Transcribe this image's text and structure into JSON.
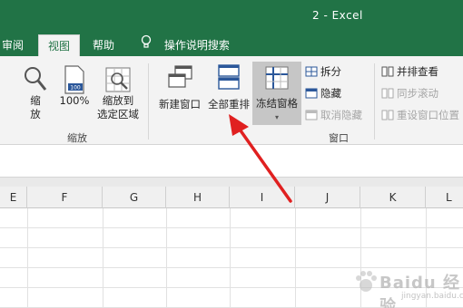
{
  "window": {
    "title": "2  -  Excel"
  },
  "tabs": [
    {
      "label": "审阅"
    },
    {
      "label": "视图"
    },
    {
      "label": "帮助"
    },
    {
      "label": "操作说明搜索"
    }
  ],
  "ribbon": {
    "zoom_group": {
      "zoom_label_1": "缩",
      "zoom_label_2": "放",
      "zoom100_label": "100%",
      "zoom_selection_1": "缩放到",
      "zoom_selection_2": "选定区域",
      "group_label": "缩放"
    },
    "window_group": {
      "new_window": "新建窗口",
      "arrange_all": "全部重排",
      "freeze_panes": "冻结窗格",
      "split": "拆分",
      "hide": "隐藏",
      "unhide": "取消隐藏",
      "view_side_by_side": "并排查看",
      "sync_scroll": "同步滚动",
      "reset_position": "重设窗口位置",
      "group_label": "窗口"
    }
  },
  "columns": [
    "E",
    "F",
    "G",
    "H",
    "I",
    "J",
    "K",
    "L"
  ],
  "watermark": {
    "text": "Baidu 经验",
    "sub": "jingyan.baidu.com"
  },
  "colors": {
    "accent": "#217346",
    "arrow": "#e02020"
  }
}
